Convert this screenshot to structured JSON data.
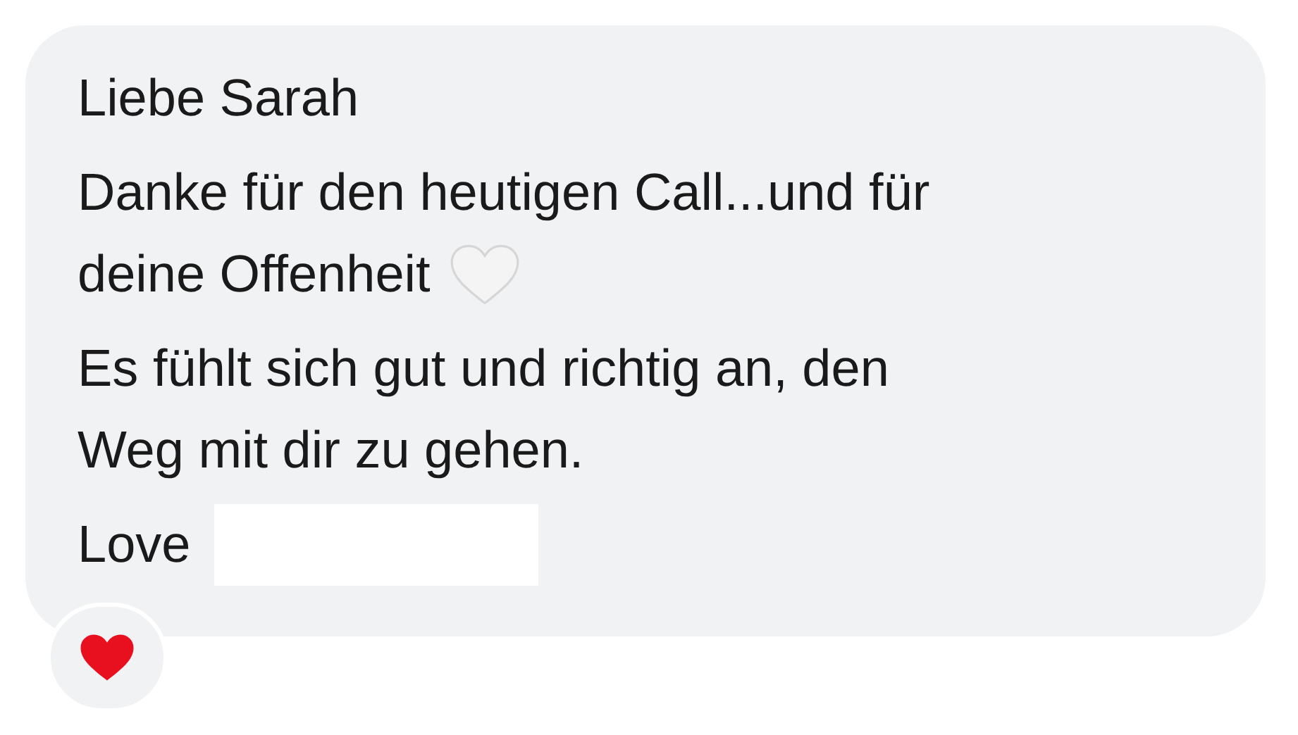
{
  "message": {
    "paragraphs": [
      {
        "lines": [
          {
            "text": "Liebe Sarah"
          }
        ]
      },
      {
        "lines": [
          {
            "text": "Danke für den heutigen Call...und für"
          },
          {
            "text": "deine Offenheit",
            "heart_after": true
          }
        ]
      },
      {
        "lines": [
          {
            "text": "Es fühlt sich gut und richtig an, den"
          },
          {
            "text": "Weg mit dir zu gehen."
          }
        ]
      },
      {
        "lines": [
          {
            "text": "Love",
            "redacted": true
          }
        ]
      }
    ]
  },
  "reactions": [
    {
      "kind": "heart"
    }
  ]
}
